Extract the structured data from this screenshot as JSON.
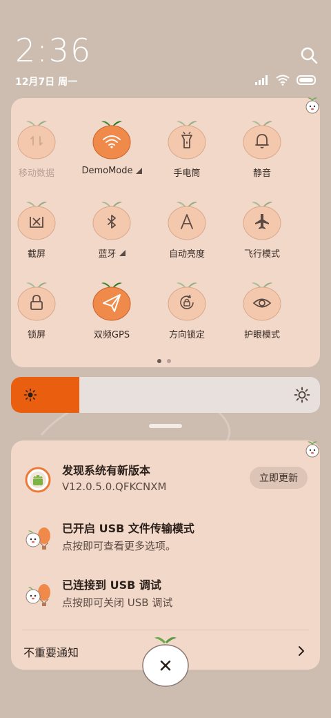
{
  "status": {
    "time": "2:36",
    "date": "12月7日 周一",
    "icons": [
      "signal-icon",
      "wifi-icon",
      "battery-icon"
    ]
  },
  "header": {
    "search_icon": "search-icon"
  },
  "quick_settings": {
    "tiles": [
      {
        "label": "移动数据",
        "icon": "mobile-data-icon",
        "active": false,
        "dim": true,
        "has_arrow": false
      },
      {
        "label": "DemoMode",
        "icon": "wifi-icon",
        "active": true,
        "dim": false,
        "has_arrow": true
      },
      {
        "label": "手电筒",
        "icon": "flashlight-icon",
        "active": false,
        "dim": false,
        "has_arrow": false
      },
      {
        "label": "静音",
        "icon": "bell-icon",
        "active": false,
        "dim": false,
        "has_arrow": false
      },
      {
        "label": "截屏",
        "icon": "screenshot-icon",
        "active": false,
        "dim": false,
        "has_arrow": false
      },
      {
        "label": "蓝牙",
        "icon": "bluetooth-icon",
        "active": false,
        "dim": false,
        "has_arrow": true
      },
      {
        "label": "自动亮度",
        "icon": "auto-brightness-icon",
        "active": false,
        "dim": false,
        "has_arrow": false
      },
      {
        "label": "飞行模式",
        "icon": "airplane-icon",
        "active": false,
        "dim": false,
        "has_arrow": false
      },
      {
        "label": "锁屏",
        "icon": "lock-icon",
        "active": false,
        "dim": false,
        "has_arrow": false
      },
      {
        "label": "双频GPS",
        "icon": "gps-icon",
        "active": true,
        "dim": false,
        "has_arrow": false
      },
      {
        "label": "方向锁定",
        "icon": "rotation-lock-icon",
        "active": false,
        "dim": false,
        "has_arrow": false
      },
      {
        "label": "护眼模式",
        "icon": "eye-icon",
        "active": false,
        "dim": false,
        "has_arrow": false
      }
    ],
    "page_count": 2,
    "current_page": 1
  },
  "brightness": {
    "level": 0.22,
    "low_icon": "sun-small-icon",
    "high_icon": "sun-large-icon"
  },
  "notifications": [
    {
      "title": "发现系统有新版本",
      "subtitle": "V12.0.5.0.QFKCNXM",
      "icon": "android-update-icon",
      "action": "立即更新"
    },
    {
      "title": "已开启 USB 文件传输模式",
      "subtitle": "点按即可查看更多选项。",
      "icon": "usb-mascot-icon"
    },
    {
      "title": "已连接到 USB 调试",
      "subtitle": "点按即可关闭 USB 调试",
      "icon": "usb-mascot-icon"
    }
  ],
  "unimportant": {
    "label": "不重要通知"
  },
  "colors": {
    "accent": "#ea5f0f",
    "fruit_active": "#f08a4b",
    "fruit_inactive": "#f4c8ad",
    "panel": "#f1d8c9",
    "background": "#cdbdb1"
  }
}
